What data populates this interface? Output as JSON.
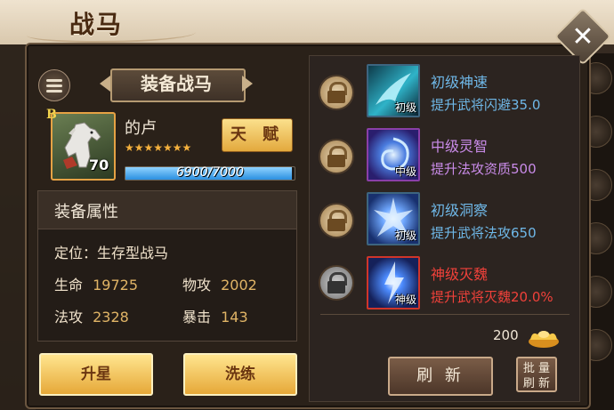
{
  "window": {
    "title": "战马"
  },
  "left": {
    "equip_label": "装备战马",
    "horse": {
      "grade": "B",
      "level": "70",
      "name": "的卢",
      "stars": 7,
      "stars_text": "★★★★★★★",
      "talent_label": "天 赋",
      "exp_text": "6900/7000",
      "exp_fraction": 0.9857
    },
    "attributes": {
      "title": "装备属性",
      "position_label": "定位：",
      "position_value": "生存型战马",
      "hp_label": "生命",
      "hp_value": "19725",
      "patk_label": "物攻",
      "patk_value": "2002",
      "matk_label": "法攻",
      "matk_value": "2328",
      "crit_label": "暴击",
      "crit_value": "143"
    },
    "buttons": {
      "upgrade": "升星",
      "refine": "洗练"
    }
  },
  "right": {
    "skills": [
      {
        "name": "初级神速",
        "desc": "提升武将闪避35.0",
        "tag": "初级",
        "name_color": "#6fb8e8",
        "desc_color": "#6fb8e8",
        "lock": "gold"
      },
      {
        "name": "中级灵智",
        "desc": "提升法攻资质500",
        "tag": "中级",
        "name_color": "#c98be8",
        "desc_color": "#c98be8",
        "lock": "gold"
      },
      {
        "name": "初级洞察",
        "desc": "提升武将法攻650",
        "tag": "初级",
        "name_color": "#6fb8e8",
        "desc_color": "#6fb8e8",
        "lock": "gold"
      },
      {
        "name": "神级灭魏",
        "desc": "提升武将灭魏20.0%",
        "tag": "神级",
        "name_color": "#f0413a",
        "desc_color": "#f0413a",
        "lock": "grey"
      }
    ],
    "cost": "200",
    "refresh_label": "刷 新",
    "batch_label_line1": "批 量",
    "batch_label_line2": "刷 新"
  }
}
